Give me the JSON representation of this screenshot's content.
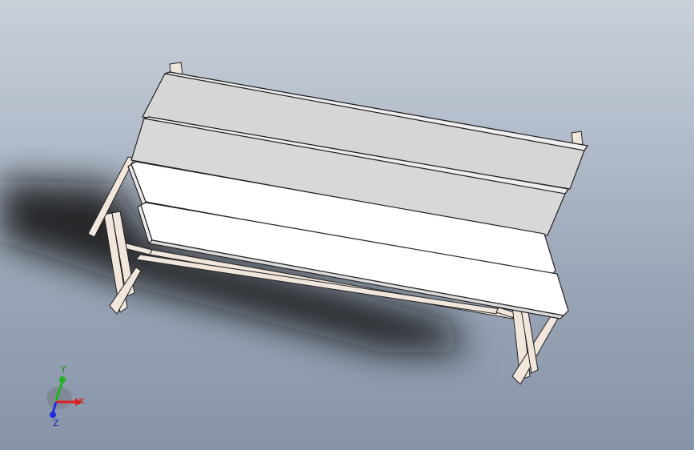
{
  "viewport": {
    "background_top": "#c9d0d8",
    "background_bottom": "#8794a8"
  },
  "model": {
    "name_icon": "bench-3d-model",
    "frame_color": "#f1e6dc",
    "backrest_color": "#d8d8d8",
    "seat_color": "#ffffff",
    "edge_color": "#222222"
  },
  "triad": {
    "x_label": "X",
    "y_label": "Y",
    "z_label": "Z",
    "x_color": "#e02020",
    "y_color": "#20b020",
    "z_color": "#2030e0"
  }
}
